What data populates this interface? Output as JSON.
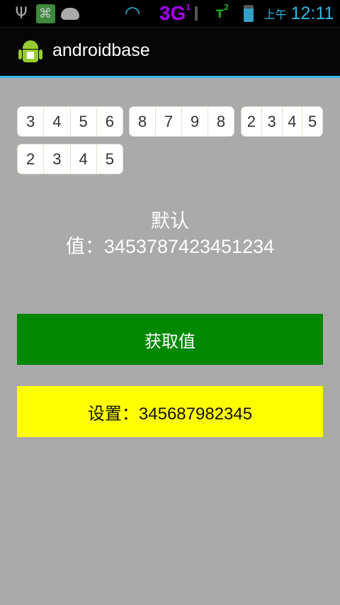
{
  "status_bar": {
    "icons": [
      "usb-icon",
      "bug-icon",
      "android-debug-icon",
      "wifi-icon",
      "3g-signal-icon",
      "sim2-no-signal-icon",
      "battery-charging-icon"
    ],
    "network": "3G",
    "sim1": "1",
    "sim2": "2",
    "ampm": "上午",
    "time": "12:11",
    "colors": {
      "clock": "#33b5e5",
      "network": "#aa00ff",
      "sim2": "#22aa22"
    }
  },
  "app_bar": {
    "title": "androidbase",
    "accent": "#33b5e5"
  },
  "number_groups": [
    {
      "digits": [
        "3",
        "4",
        "5",
        "6"
      ]
    },
    {
      "digits": [
        "8",
        "7",
        "9",
        "8"
      ]
    },
    {
      "digits": [
        "2",
        "3",
        "4",
        "5"
      ]
    },
    {
      "digits": [
        "2",
        "3",
        "4",
        "5"
      ]
    }
  ],
  "default_value": {
    "line1": "默认",
    "line2": "值：3453787423451234"
  },
  "get_button": {
    "label": "获取值",
    "color": "#008800"
  },
  "set_button": {
    "label": "设置：345687982345",
    "color": "#ffff00"
  }
}
